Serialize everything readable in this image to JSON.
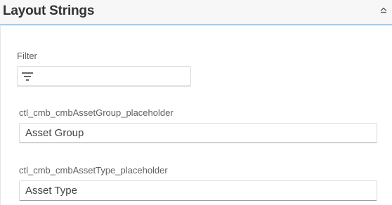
{
  "header": {
    "title": "Layout Strings",
    "collapse_icon": "chevron-up-icon"
  },
  "filter": {
    "label": "Filter",
    "value": "",
    "icon": "filter-icon"
  },
  "fields": [
    {
      "label": "ctl_cmb_cmbAssetGroup_placeholder",
      "value": "Asset Group"
    },
    {
      "label": "ctl_cmb_cmbAssetType_placeholder",
      "value": "Asset Type"
    }
  ],
  "colors": {
    "accent": "#1e88e5",
    "header_bg": "#f7f7f7"
  }
}
